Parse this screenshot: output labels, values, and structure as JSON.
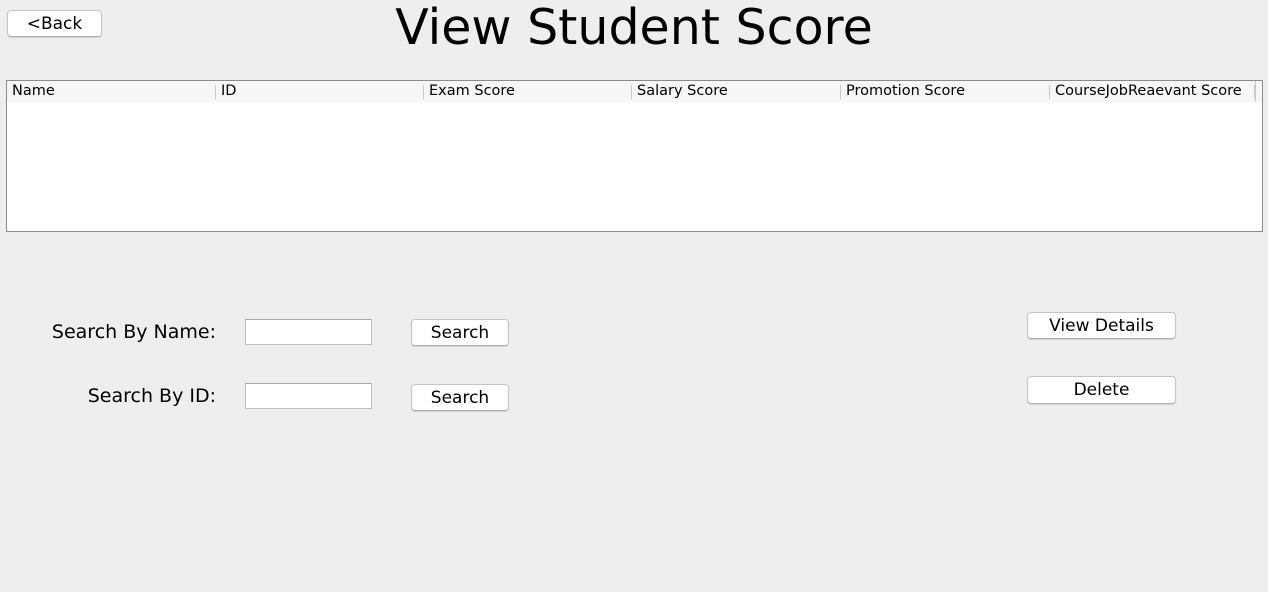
{
  "header": {
    "back_label": "<Back",
    "title": "View Student Score"
  },
  "table": {
    "columns": [
      "Name",
      "ID",
      "Exam Score",
      "Salary Score",
      "Promotion Score",
      "CourseJobReaevant Score",
      ""
    ],
    "rows": []
  },
  "search": {
    "name_label": "Search By Name:",
    "name_value": "",
    "name_button": "Search",
    "id_label": "Search By ID:",
    "id_value": "",
    "id_button": "Search"
  },
  "actions": {
    "view_details_label": "View Details",
    "delete_label": "Delete"
  }
}
